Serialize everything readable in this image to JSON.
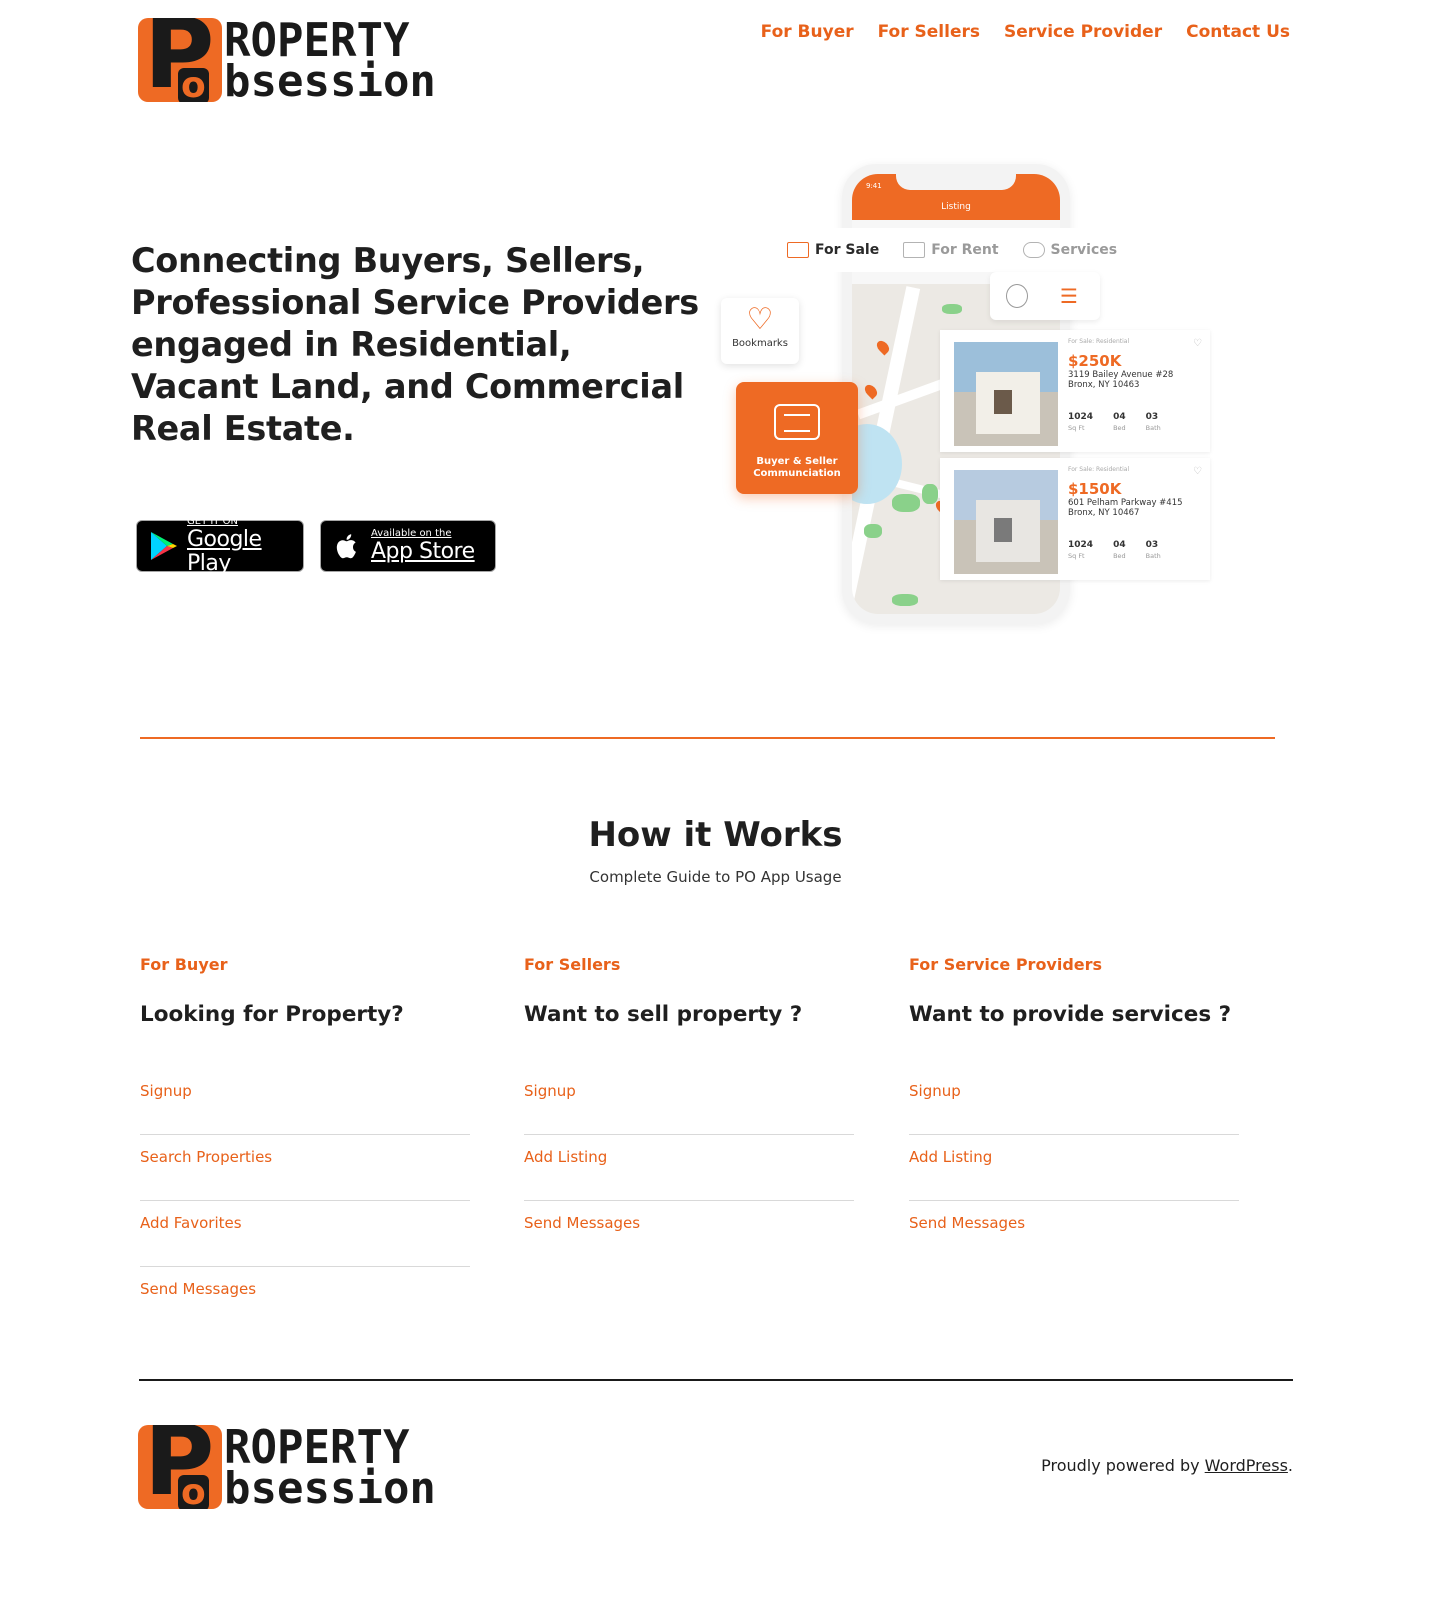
{
  "brand": {
    "logo_letter_p": "P",
    "logo_letter_o": "o",
    "logo_word_1": "ROPERTY",
    "logo_word_2": "bsession",
    "accent_color": "#ee6a24"
  },
  "nav": {
    "items": [
      {
        "label": "For Buyer"
      },
      {
        "label": "For Sellers"
      },
      {
        "label": "Service Provider"
      },
      {
        "label": "Contact Us"
      }
    ]
  },
  "hero": {
    "title": "Connecting Buyers, Sellers, Professional Service Providers engaged in Residential, Vacant Land, and Commercial Real Estate.",
    "google_play": {
      "small": "GET IT ON",
      "big": "Google Play"
    },
    "app_store": {
      "small": "Available on the",
      "big": "App Store"
    }
  },
  "mockup": {
    "screen_title": "Listing",
    "time": "9:41",
    "tabs": [
      {
        "label": "For Sale",
        "active": true
      },
      {
        "label": "For Rent",
        "active": false
      },
      {
        "label": "Services",
        "active": false
      }
    ],
    "bookmarks_label": "Bookmarks",
    "communication_label": "Buyer & Seller Communciation",
    "listings": [
      {
        "category": "For Sale: Residential",
        "price": "$250K",
        "address": "3119 Bailey Avenue #28 Bronx, NY 10463",
        "sqft": "1024",
        "sqft_label": "Sq Ft",
        "bed": "04",
        "bed_label": "Bed",
        "bath": "03",
        "bath_label": "Bath"
      },
      {
        "category": "For Sale: Residential",
        "price": "$150K",
        "address": "601 Pelham Parkway #415 Bronx, NY 10467",
        "sqft": "1024",
        "sqft_label": "Sq Ft",
        "bed": "04",
        "bed_label": "Bed",
        "bath": "03",
        "bath_label": "Bath"
      }
    ]
  },
  "how_it_works": {
    "title": "How it Works",
    "subtitle": "Complete Guide to PO App Usage",
    "columns": [
      {
        "kicker": "For Buyer",
        "title": "Looking for Property?",
        "links": [
          "Signup",
          "Search Properties",
          "Add Favorites",
          "Send Messages"
        ]
      },
      {
        "kicker": "For Sellers",
        "title": "Want to sell property ?",
        "links": [
          "Signup",
          "Add Listing",
          "Send Messages"
        ]
      },
      {
        "kicker": "For Service Providers",
        "title": "Want to provide services ?",
        "links": [
          "Signup",
          "Add Listing",
          "Send Messages"
        ]
      }
    ]
  },
  "footer": {
    "powered_prefix": "Proudly powered by ",
    "powered_link": "WordPress",
    "powered_suffix": "."
  }
}
